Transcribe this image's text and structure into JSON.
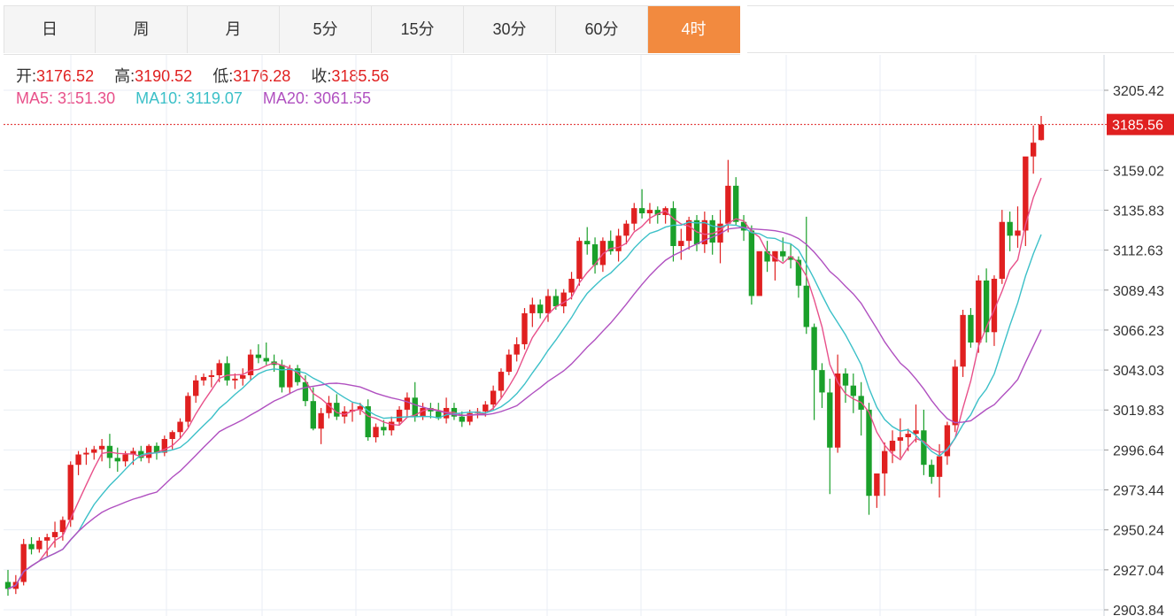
{
  "tabs": [
    {
      "label": "日",
      "active": false
    },
    {
      "label": "周",
      "active": false
    },
    {
      "label": "月",
      "active": false
    },
    {
      "label": "5分",
      "active": false
    },
    {
      "label": "15分",
      "active": false
    },
    {
      "label": "30分",
      "active": false
    },
    {
      "label": "60分",
      "active": false
    },
    {
      "label": "4时",
      "active": true
    }
  ],
  "ohlc": {
    "open_label": "开:",
    "open": "3176.52",
    "high_label": "高:",
    "high": "3190.52",
    "low_label": "低:",
    "low": "3176.28",
    "close_label": "收:",
    "close": "3185.56"
  },
  "ma": {
    "ma5_label": "MA5:",
    "ma5": "3151.30",
    "ma10_label": "MA10:",
    "ma10": "3119.07",
    "ma20_label": "MA20:",
    "ma20": "3061.55"
  },
  "colors": {
    "up": "#e02020",
    "down": "#1aa02a",
    "ma5": "#e8508a",
    "ma10": "#3cc0c8",
    "ma20": "#b050c0",
    "accent": "#f28a3f"
  },
  "chart_data": {
    "type": "candlestick",
    "ylim": [
      2903.84,
      3218
    ],
    "y_ticks": [
      "3205.42",
      "3159.02",
      "3135.83",
      "3112.63",
      "3089.43",
      "3066.23",
      "3043.03",
      "3019.83",
      "2996.64",
      "2973.44",
      "2950.24",
      "2927.04",
      "2903.84"
    ],
    "last_price": "3185.56",
    "ohlc": [
      [
        2920,
        2927,
        2912,
        2916
      ],
      [
        2916,
        2924,
        2913,
        2920
      ],
      [
        2920,
        2945,
        2918,
        2942
      ],
      [
        2942,
        2946,
        2936,
        2939
      ],
      [
        2939,
        2946,
        2937,
        2944
      ],
      [
        2944,
        2948,
        2935,
        2946
      ],
      [
        2946,
        2955,
        2940,
        2949
      ],
      [
        2949,
        2958,
        2944,
        2956
      ],
      [
        2956,
        2990,
        2952,
        2988
      ],
      [
        2988,
        2996,
        2982,
        2994
      ],
      [
        2994,
        2998,
        2988,
        2995
      ],
      [
        2995,
        2999,
        2991,
        2997
      ],
      [
        2997,
        3003,
        2990,
        2999
      ],
      [
        2999,
        3006,
        2986,
        2992
      ],
      [
        2992,
        2998,
        2984,
        2990
      ],
      [
        2990,
        2996,
        2987,
        2994
      ],
      [
        2994,
        2998,
        2988,
        2996
      ],
      [
        2996,
        2999,
        2990,
        2992
      ],
      [
        2992,
        3000,
        2989,
        2999
      ],
      [
        2999,
        3001,
        2991,
        2995
      ],
      [
        2995,
        3005,
        2993,
        3003
      ],
      [
        3003,
        3008,
        2997,
        3007
      ],
      [
        3007,
        3015,
        3003,
        3013
      ],
      [
        3013,
        3030,
        3010,
        3028
      ],
      [
        3028,
        3040,
        3024,
        3037
      ],
      [
        3037,
        3041,
        3034,
        3039
      ],
      [
        3039,
        3043,
        3033,
        3040
      ],
      [
        3040,
        3049,
        3036,
        3047
      ],
      [
        3047,
        3051,
        3034,
        3037
      ],
      [
        3037,
        3041,
        3032,
        3038
      ],
      [
        3038,
        3044,
        3034,
        3040
      ],
      [
        3040,
        3055,
        3037,
        3052
      ],
      [
        3052,
        3058,
        3047,
        3050
      ],
      [
        3050,
        3059,
        3046,
        3048
      ],
      [
        3048,
        3052,
        3042,
        3046
      ],
      [
        3046,
        3049,
        3030,
        3033
      ],
      [
        3033,
        3046,
        3029,
        3044
      ],
      [
        3044,
        3046,
        3034,
        3036
      ],
      [
        3036,
        3040,
        3022,
        3025
      ],
      [
        3025,
        3033,
        3008,
        3009
      ],
      [
        3009,
        3021,
        3000,
        3018
      ],
      [
        3018,
        3028,
        3015,
        3024
      ],
      [
        3024,
        3029,
        3014,
        3016
      ],
      [
        3016,
        3022,
        3012,
        3019
      ],
      [
        3019,
        3024,
        3013,
        3020
      ],
      [
        3020,
        3024,
        3017,
        3022
      ],
      [
        3022,
        3026,
        3002,
        3004
      ],
      [
        3004,
        3012,
        3001,
        3010
      ],
      [
        3010,
        3014,
        3005,
        3008
      ],
      [
        3008,
        3016,
        3005,
        3013
      ],
      [
        3013,
        3022,
        3011,
        3020
      ],
      [
        3020,
        3030,
        3016,
        3027
      ],
      [
        3027,
        3036,
        3013,
        3016
      ],
      [
        3016,
        3024,
        3014,
        3021
      ],
      [
        3021,
        3024,
        3015,
        3019
      ],
      [
        3019,
        3024,
        3014,
        3015
      ],
      [
        3015,
        3027,
        3012,
        3021
      ],
      [
        3021,
        3024,
        3014,
        3016
      ],
      [
        3016,
        3019,
        3010,
        3013
      ],
      [
        3013,
        3020,
        3011,
        3018
      ],
      [
        3018,
        3021,
        3015,
        3019
      ],
      [
        3019,
        3025,
        3016,
        3023
      ],
      [
        3023,
        3034,
        3020,
        3031
      ],
      [
        3031,
        3044,
        3027,
        3042
      ],
      [
        3042,
        3055,
        3040,
        3052
      ],
      [
        3052,
        3062,
        3048,
        3058
      ],
      [
        3058,
        3079,
        3055,
        3076
      ],
      [
        3076,
        3085,
        3068,
        3081
      ],
      [
        3081,
        3084,
        3073,
        3076
      ],
      [
        3076,
        3090,
        3071,
        3086
      ],
      [
        3086,
        3090,
        3078,
        3080
      ],
      [
        3080,
        3090,
        3076,
        3088
      ],
      [
        3088,
        3100,
        3084,
        3096
      ],
      [
        3096,
        3120,
        3092,
        3118
      ],
      [
        3118,
        3126,
        3110,
        3116
      ],
      [
        3116,
        3120,
        3099,
        3104
      ],
      [
        3104,
        3120,
        3100,
        3118
      ],
      [
        3118,
        3124,
        3110,
        3112
      ],
      [
        3112,
        3125,
        3106,
        3121
      ],
      [
        3121,
        3130,
        3116,
        3128
      ],
      [
        3128,
        3140,
        3124,
        3137
      ],
      [
        3137,
        3148,
        3131,
        3134
      ],
      [
        3134,
        3140,
        3128,
        3136
      ],
      [
        3136,
        3138,
        3128,
        3133
      ],
      [
        3133,
        3138,
        3128,
        3137
      ],
      [
        3137,
        3141,
        3106,
        3115
      ],
      [
        3115,
        3125,
        3107,
        3118
      ],
      [
        3118,
        3132,
        3113,
        3130
      ],
      [
        3130,
        3133,
        3112,
        3116
      ],
      [
        3116,
        3135,
        3111,
        3130
      ],
      [
        3130,
        3133,
        3110,
        3117
      ],
      [
        3117,
        3136,
        3105,
        3128
      ],
      [
        3128,
        3165,
        3123,
        3150
      ],
      [
        3150,
        3155,
        3127,
        3129
      ],
      [
        3129,
        3133,
        3118,
        3124
      ],
      [
        3124,
        3127,
        3081,
        3086
      ],
      [
        3086,
        3110,
        3088,
        3112
      ],
      [
        3112,
        3118,
        3100,
        3106
      ],
      [
        3106,
        3112,
        3095,
        3112
      ],
      [
        3112,
        3120,
        3106,
        3109
      ],
      [
        3109,
        3116,
        3102,
        3107
      ],
      [
        3107,
        3109,
        3085,
        3092
      ],
      [
        3092,
        3132,
        3064,
        3068
      ],
      [
        3068,
        3070,
        3014,
        3043
      ],
      [
        3043,
        3047,
        3021,
        3030
      ],
      [
        3030,
        3038,
        2971,
        2998
      ],
      [
        2998,
        3052,
        2995,
        3041
      ],
      [
        3041,
        3044,
        3024,
        3034
      ],
      [
        3034,
        3041,
        3018,
        3028
      ],
      [
        3028,
        3036,
        3005,
        3020
      ],
      [
        3020,
        3024,
        2959,
        2970
      ],
      [
        2970,
        2980,
        2963,
        2983
      ],
      [
        2983,
        3001,
        2970,
        2996
      ],
      [
        2996,
        3008,
        2989,
        3002
      ],
      [
        3002,
        3015,
        2992,
        3004
      ],
      [
        3004,
        3009,
        2996,
        3006
      ],
      [
        3006,
        3023,
        3001,
        3008
      ],
      [
        3008,
        3020,
        2982,
        2988
      ],
      [
        2988,
        2991,
        2977,
        2981
      ],
      [
        2981,
        3000,
        2969,
        2993
      ],
      [
        2993,
        3013,
        2988,
        3011
      ],
      [
        3011,
        3049,
        3007,
        3045
      ],
      [
        3045,
        3078,
        3039,
        3075
      ],
      [
        3075,
        3079,
        3056,
        3059
      ],
      [
        3059,
        3098,
        3053,
        3095
      ],
      [
        3095,
        3102,
        3059,
        3065
      ],
      [
        3065,
        3098,
        3057,
        3096
      ],
      [
        3096,
        3136,
        3093,
        3129
      ],
      [
        3129,
        3135,
        3112,
        3121
      ],
      [
        3121,
        3138,
        3114,
        3124
      ],
      [
        3124,
        3160,
        3115,
        3167
      ],
      [
        3167,
        3185,
        3157,
        3175
      ],
      [
        3176.52,
        3190.52,
        3176.28,
        3185.56
      ]
    ]
  }
}
